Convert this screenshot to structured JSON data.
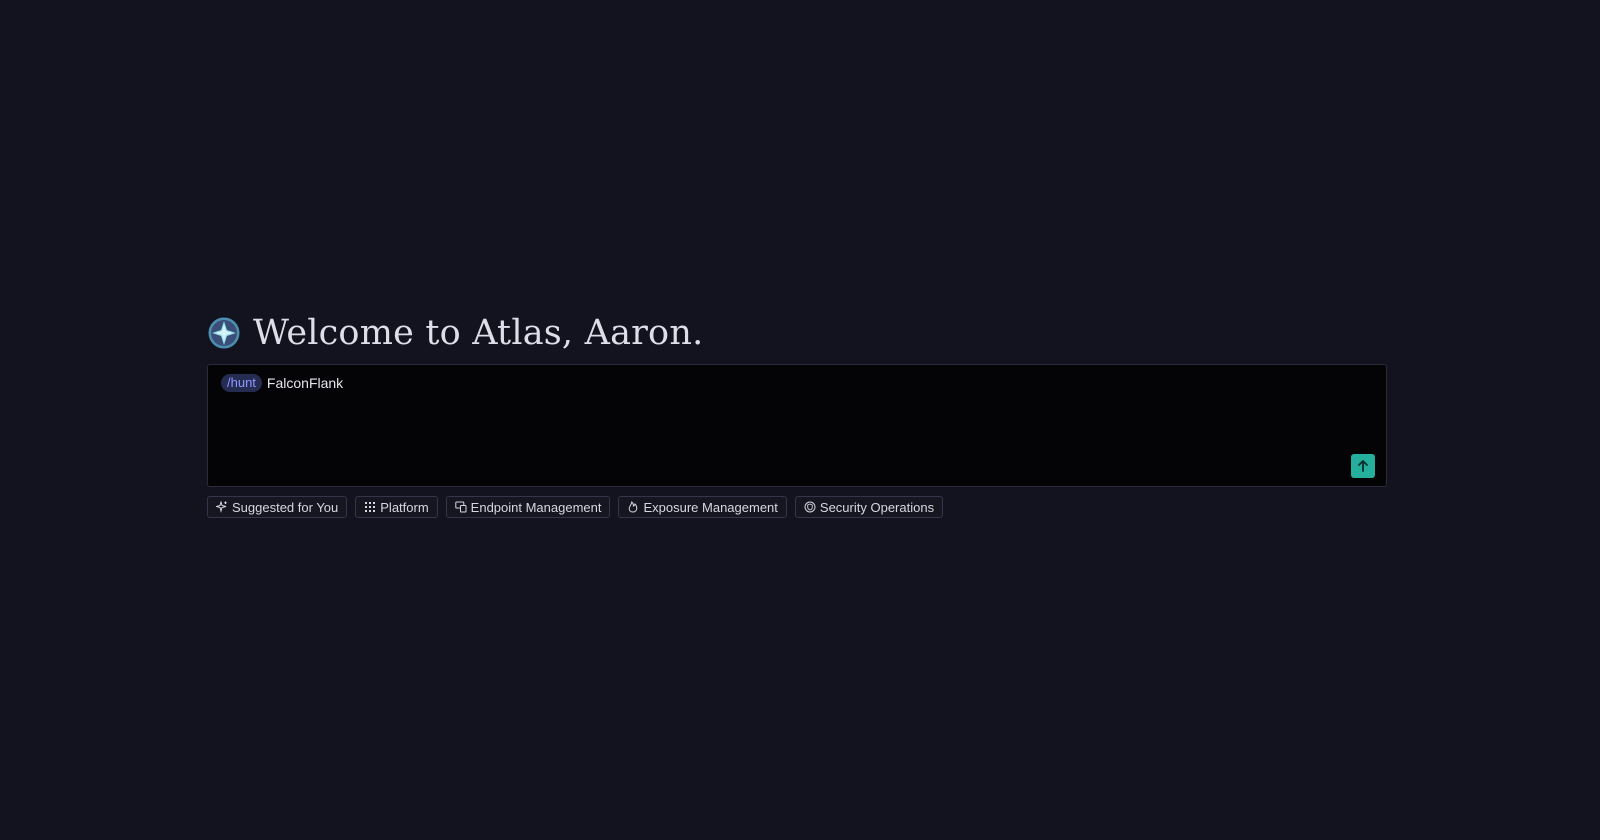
{
  "header": {
    "title": "Welcome to Atlas, Aaron."
  },
  "prompt": {
    "command": "/hunt",
    "value": "FalconFlank"
  },
  "suggestions": [
    {
      "label": "Suggested for You",
      "icon": "sparkle-icon"
    },
    {
      "label": "Platform",
      "icon": "grid-icon"
    },
    {
      "label": "Endpoint Management",
      "icon": "devices-icon"
    },
    {
      "label": "Exposure Management",
      "icon": "flame-icon"
    },
    {
      "label": "Security Operations",
      "icon": "shield-icon"
    }
  ],
  "colors": {
    "background": "#13131f",
    "accent": "#24b09d",
    "command": "#8d98ff"
  }
}
